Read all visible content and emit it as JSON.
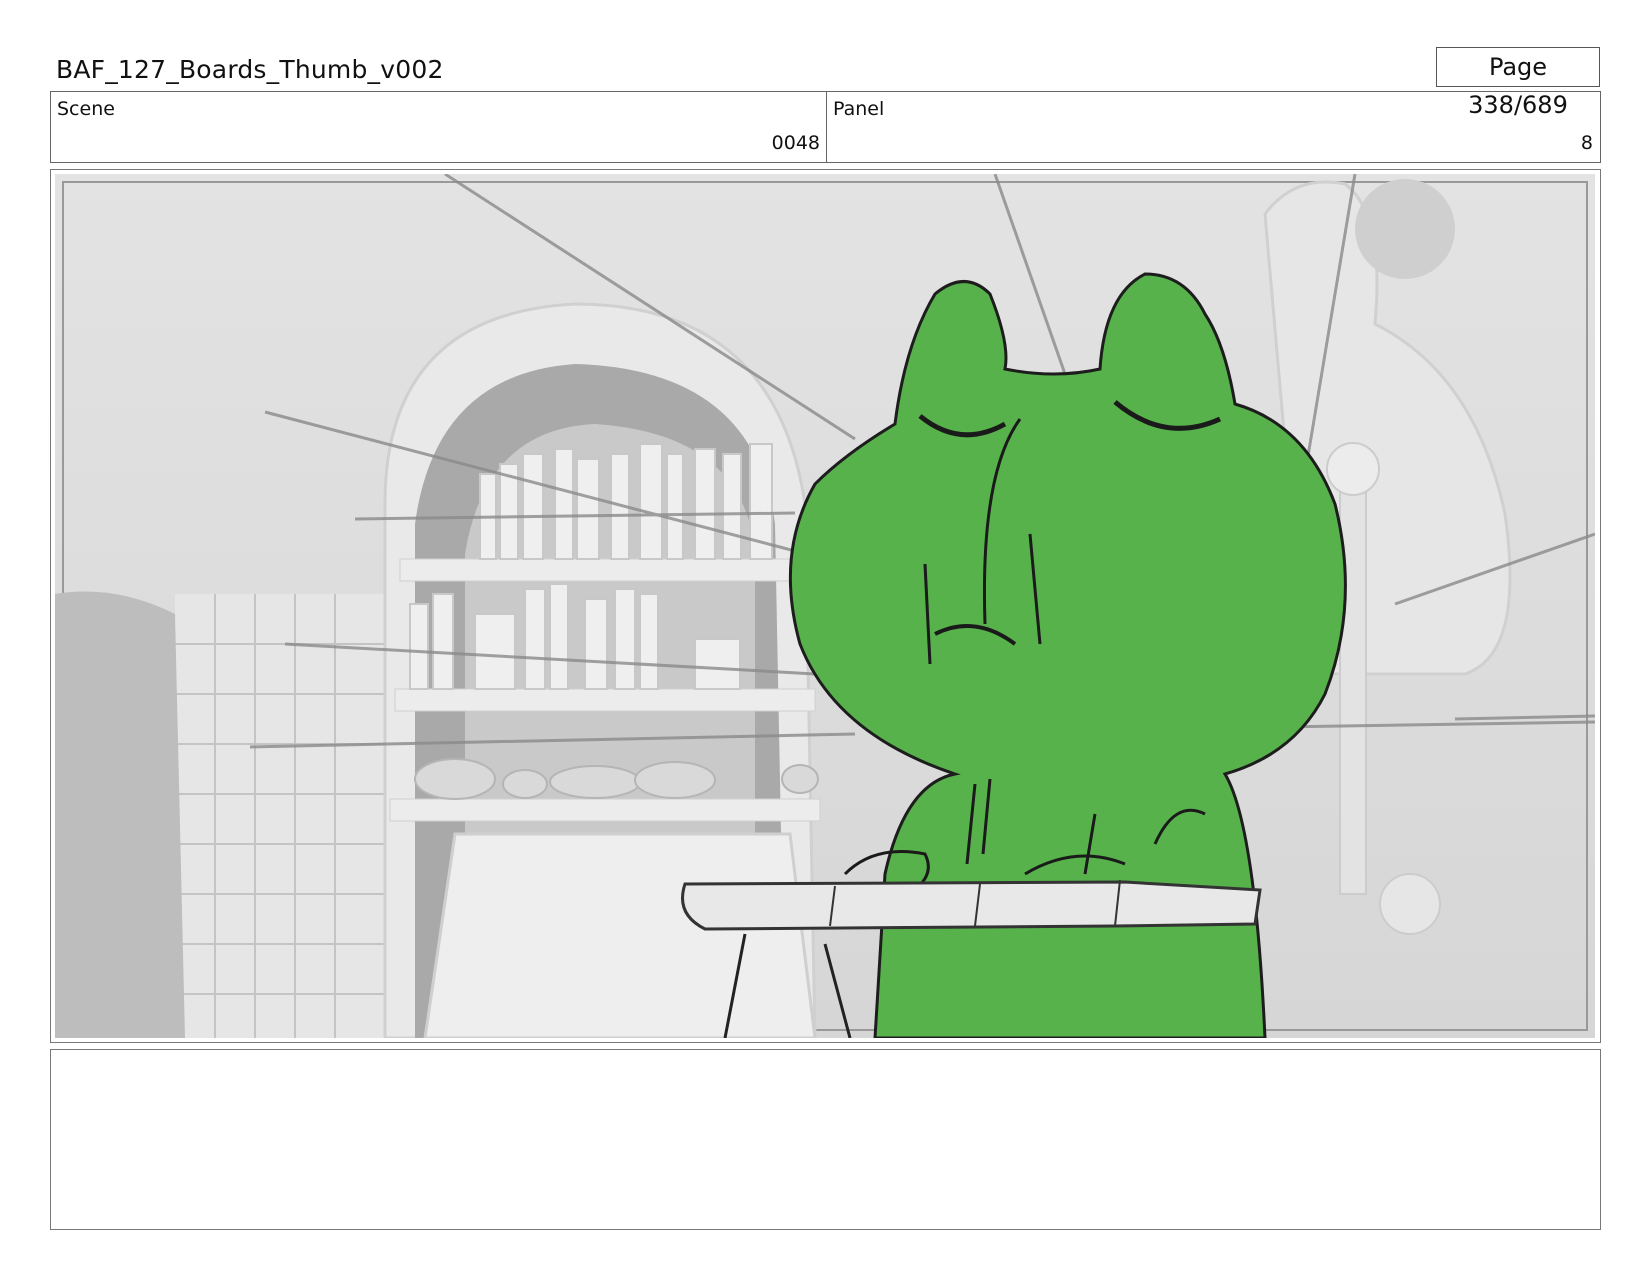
{
  "document": {
    "title": "BAF_127_Boards_Thumb_v002",
    "page_label": "Page 338/689"
  },
  "info": {
    "scene_label": "Scene",
    "scene_value": "0048",
    "panel_label": "Panel",
    "panel_value": "8"
  },
  "frame": {
    "description_icon": "storyboard-frame-image",
    "character_color": "#58b24c",
    "background_tone": "#dcdcdc"
  },
  "notes": {
    "text": ""
  }
}
